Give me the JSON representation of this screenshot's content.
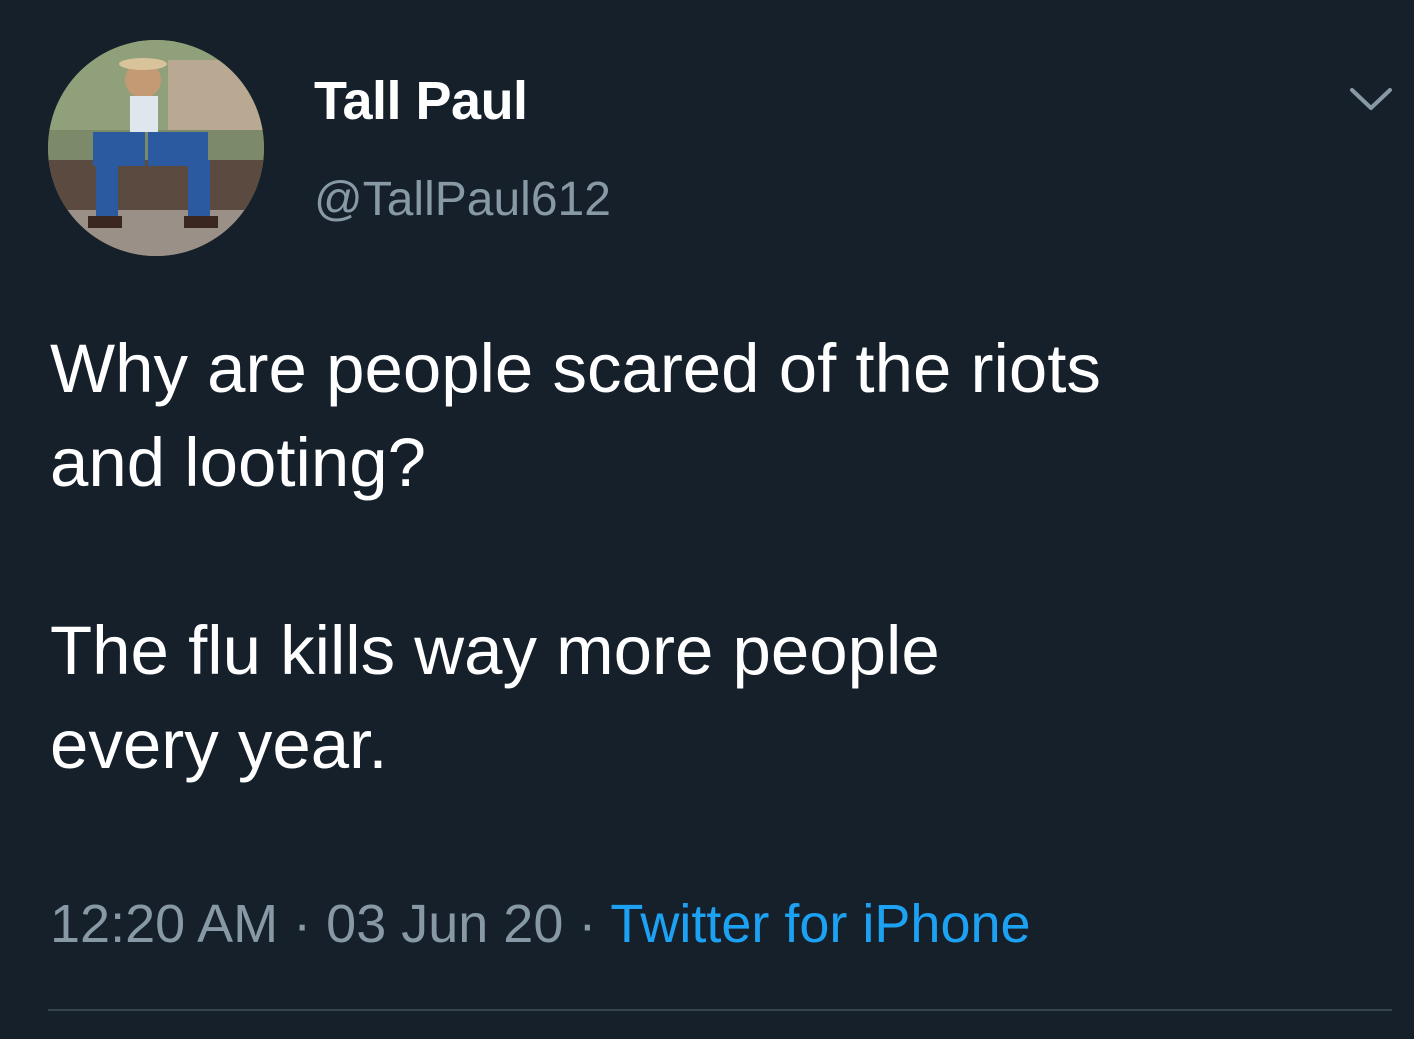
{
  "tweet": {
    "author": {
      "display_name": "Tall Paul",
      "handle": "@TallPaul612"
    },
    "text": {
      "paragraph_1": "Why are people scared of the riots\nand looting?",
      "paragraph_2": "The flu kills way more people\nevery year."
    },
    "meta": {
      "time": "12:20 AM",
      "separator": " · ",
      "date": "03 Jun 20",
      "source": "Twitter for iPhone"
    }
  },
  "colors": {
    "background": "#15202b",
    "primary_text": "#ffffff",
    "secondary_text": "#8899a6",
    "accent": "#1da1f2",
    "divider": "#38444d"
  },
  "icons": {
    "menu": "chevron-down-icon"
  }
}
